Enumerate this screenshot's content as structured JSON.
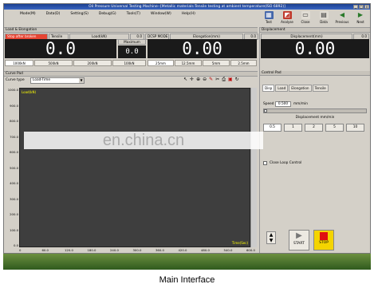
{
  "window": {
    "title": "Oil Pressure Universal Testing Machine--[Metallic materials-Tensile testing at ambient temperature(ISO 6892)]"
  },
  "menu": [
    "Mode(M)",
    "Data(D)",
    "Setting(S)",
    "Debug(G)",
    "Tools(T)",
    "Window(W)",
    "Help(H)"
  ],
  "toolbar": [
    "Test",
    "Analyse",
    "Close",
    "Data",
    "Previous",
    "Next"
  ],
  "load_section": {
    "title": "Load & Elongation",
    "status": "Stop after broken",
    "mode": "Tensile",
    "load_label": "Load(kN)",
    "load_zero": "0.0",
    "load_value": "0.0",
    "maximum_label": "Maximum",
    "maximum_value": "0.0",
    "dcsp_label": "DCSP MODE",
    "elong_label": "Elongation(mm)",
    "elong_zero": "0.0",
    "elong_value": "0.00"
  },
  "load_ranges": [
    "1000kN",
    "500kN",
    "200kN",
    "100kN"
  ],
  "elong_ranges": [
    "25mm",
    "12.5mm",
    "5mm",
    "2.5mm"
  ],
  "displacement": {
    "title": "Displacement",
    "label": "Displacement(mm)",
    "zero": "0.0",
    "value": "0.00"
  },
  "curve": {
    "title": "Curve Pad",
    "type_label": "Curve type",
    "type_value": "Load-Time",
    "y_axis": "Load(kN)",
    "x_axis": "Time(Sec)",
    "y_ticks": [
      "1000.0",
      "900.0",
      "800.0",
      "700.0",
      "600.0",
      "500.0",
      "400.0",
      "300.0",
      "200.0",
      "100.0",
      "0.0"
    ],
    "x_ticks": [
      "0",
      "60.0",
      "120.0",
      "180.0",
      "240.0",
      "300.0",
      "360.0",
      "420.0",
      "480.0",
      "540.0",
      "600.0"
    ]
  },
  "control": {
    "title": "Control Pad",
    "tabs": [
      "Disp",
      "Load",
      "Elongation",
      "Tensile"
    ],
    "speed_label": "Speed",
    "speed_value": "0.500",
    "speed_unit": "mm/min",
    "disp_label": "Displacement mm/min",
    "disp_options": [
      "0.5",
      "1",
      "2",
      "5",
      "10"
    ],
    "closeloop_label": "Close Loop Control",
    "start_label": "START",
    "stop_label": "STOP"
  },
  "watermark": "en.china.cn",
  "caption": "Main Interface"
}
